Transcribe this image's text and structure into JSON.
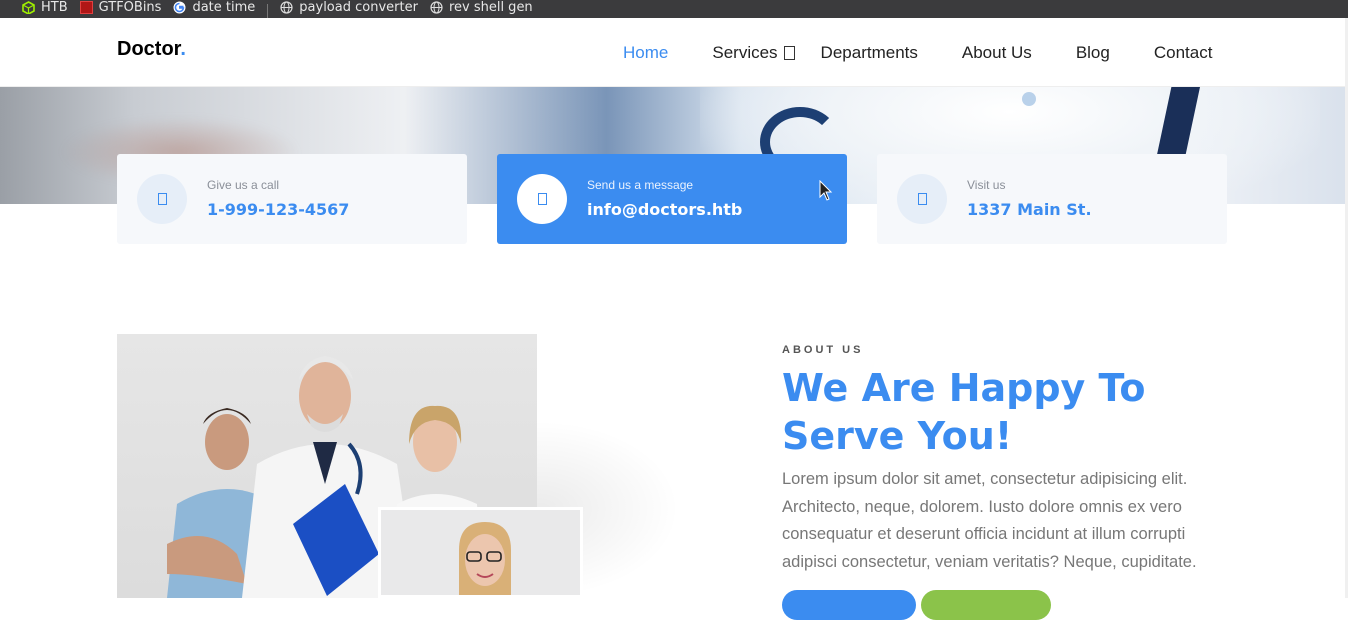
{
  "bookmarks": [
    {
      "label": "HTB",
      "icon": "htb-cube-icon"
    },
    {
      "label": "GTFOBins",
      "icon": "gtfobins-icon"
    },
    {
      "label": "date time",
      "icon": "google-icon"
    },
    {
      "label": "payload converter",
      "icon": "globe-icon"
    },
    {
      "label": "rev shell gen",
      "icon": "globe-icon"
    }
  ],
  "header": {
    "logo_text": "Doctor",
    "logo_dot": ".",
    "nav": [
      "Home",
      "Services",
      "Departments",
      "About Us",
      "Blog",
      "Contact"
    ],
    "active_index": 0
  },
  "contact_cards": [
    {
      "label": "Give us a call",
      "value": "1-999-123-4567",
      "icon": "phone-icon"
    },
    {
      "label": "Send us a message",
      "value": "info@doctors.htb",
      "icon": "mail-icon"
    },
    {
      "label": "Visit us",
      "value": "1337 Main St.",
      "icon": "location-pin-icon"
    }
  ],
  "about": {
    "eyebrow": "ABOUT US",
    "title": "We Are Happy To Serve You!",
    "body": "Lorem ipsum dolor sit amet, consectetur adipisicing elit. Architecto, neque, dolorem. Iusto dolore omnis ex vero consequatur et deserunt officia incidunt at illum corrupti adipisci consectetur, veniam veritatis? Neque, cupiditate."
  },
  "colors": {
    "accent": "#3b8cf0",
    "green": "#8bc34a",
    "bookmarks_bar": "#3b3b3d"
  }
}
